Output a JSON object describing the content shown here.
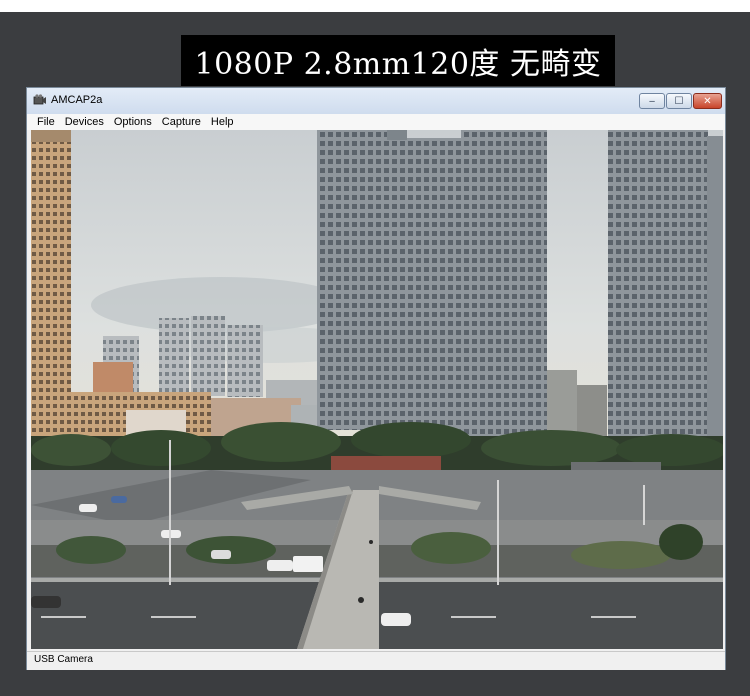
{
  "banner": {
    "text": "1080P  2.8mm120度 无畸变"
  },
  "window": {
    "title": "AMCAP2a",
    "controls": {
      "minimize": "‒",
      "maximize": "☐",
      "close": "✕"
    }
  },
  "menu": {
    "items": [
      {
        "label": "File"
      },
      {
        "label": "Devices"
      },
      {
        "label": "Options"
      },
      {
        "label": "Capture"
      },
      {
        "label": "Help"
      }
    ]
  },
  "status": {
    "text": "USB Camera"
  },
  "colors": {
    "background": "#3b3d40",
    "banner_bg": "#000000",
    "titlebar": "#d8e4f2",
    "close_button": "#c8442a"
  }
}
